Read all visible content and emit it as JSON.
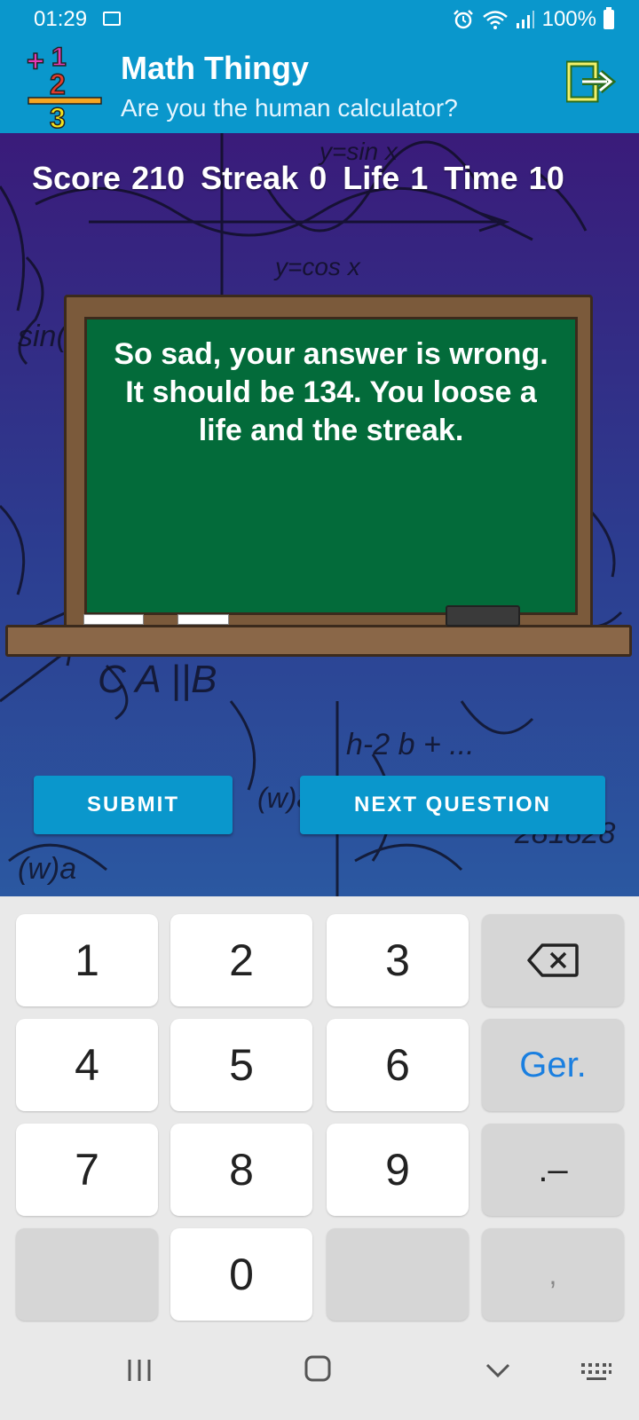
{
  "status_bar": {
    "time": "01:29",
    "battery": "100%",
    "icons": [
      "image-icon",
      "alarm-icon",
      "wifi-icon",
      "signal-icon",
      "battery-icon"
    ]
  },
  "app_bar": {
    "title": "Math Thingy",
    "subtitle": "Are you the human calculator?",
    "logo_digits": [
      "+",
      "1",
      "2",
      "3"
    ],
    "exit_icon": "exit-icon"
  },
  "game": {
    "stats": [
      {
        "label": "Score",
        "value": "210"
      },
      {
        "label": "Streak",
        "value": "0"
      },
      {
        "label": "Life",
        "value": "1"
      },
      {
        "label": "Time",
        "value": "10"
      }
    ],
    "board_message": "So sad, your answer  is wrong. It should be 134. You loose a life and the streak.",
    "buttons": {
      "submit": "SUBMIT",
      "next": "NEXT QUESTION"
    }
  },
  "keyboard": {
    "rows": [
      [
        "1",
        "2",
        "3",
        "backspace"
      ],
      [
        "4",
        "5",
        "6",
        "Ger."
      ],
      [
        "7",
        "8",
        "9",
        ".–"
      ],
      [
        "",
        "0",
        "",
        ","
      ]
    ]
  },
  "colors": {
    "primary": "#0a97cc",
    "board": "#036b3a",
    "frame": "#7b5a3b",
    "accent_key_text": "#1a7fe0"
  }
}
